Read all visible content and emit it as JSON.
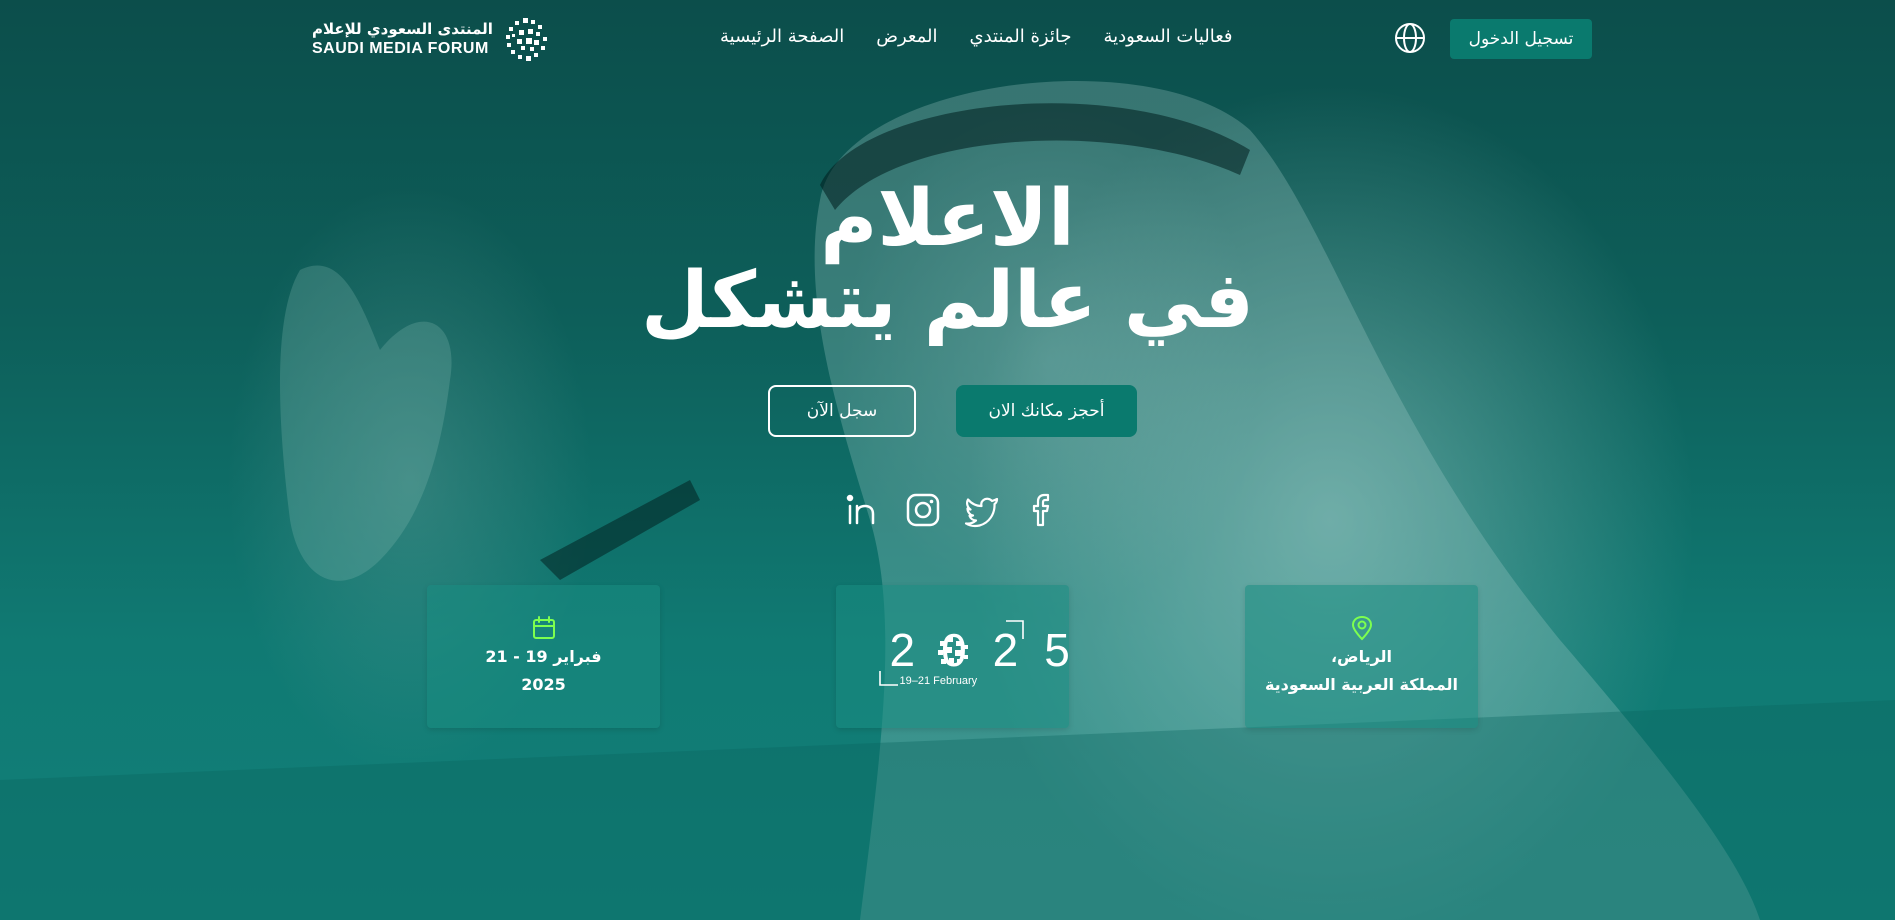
{
  "brand": {
    "name_ar": "المنتدى السعودي للإعلام",
    "name_en": "SAUDI MEDIA FORUM"
  },
  "nav": {
    "items": [
      {
        "label": "الصفحة الرئيسية"
      },
      {
        "label": "المعرض"
      },
      {
        "label": "جائزة المنتدي"
      },
      {
        "label": "فعاليات السعودية"
      }
    ]
  },
  "header": {
    "language_icon": "globe-icon",
    "login_label": "تسجيل الدخول"
  },
  "hero": {
    "title_line1": "الاعلام",
    "title_line2": "في عالم يتشكل",
    "register_label": "سجل الآن",
    "book_label": "أحجز مكانك الان"
  },
  "social": [
    "linkedin-icon",
    "instagram-icon",
    "twitter-icon",
    "facebook-icon"
  ],
  "cards": {
    "date": {
      "icon": "calendar-icon",
      "line1": "فبراير 19 - 21",
      "line2": "2025"
    },
    "event_logo": {
      "year": "2025",
      "dates": "19–21 February"
    },
    "location": {
      "icon": "location-pin-icon",
      "line1": "الرياض،",
      "line2": "المملكة العربية السعودية"
    }
  },
  "colors": {
    "accent": "#0a7a6e",
    "icon_green": "#7dff4f",
    "background": "#0f6a63"
  }
}
